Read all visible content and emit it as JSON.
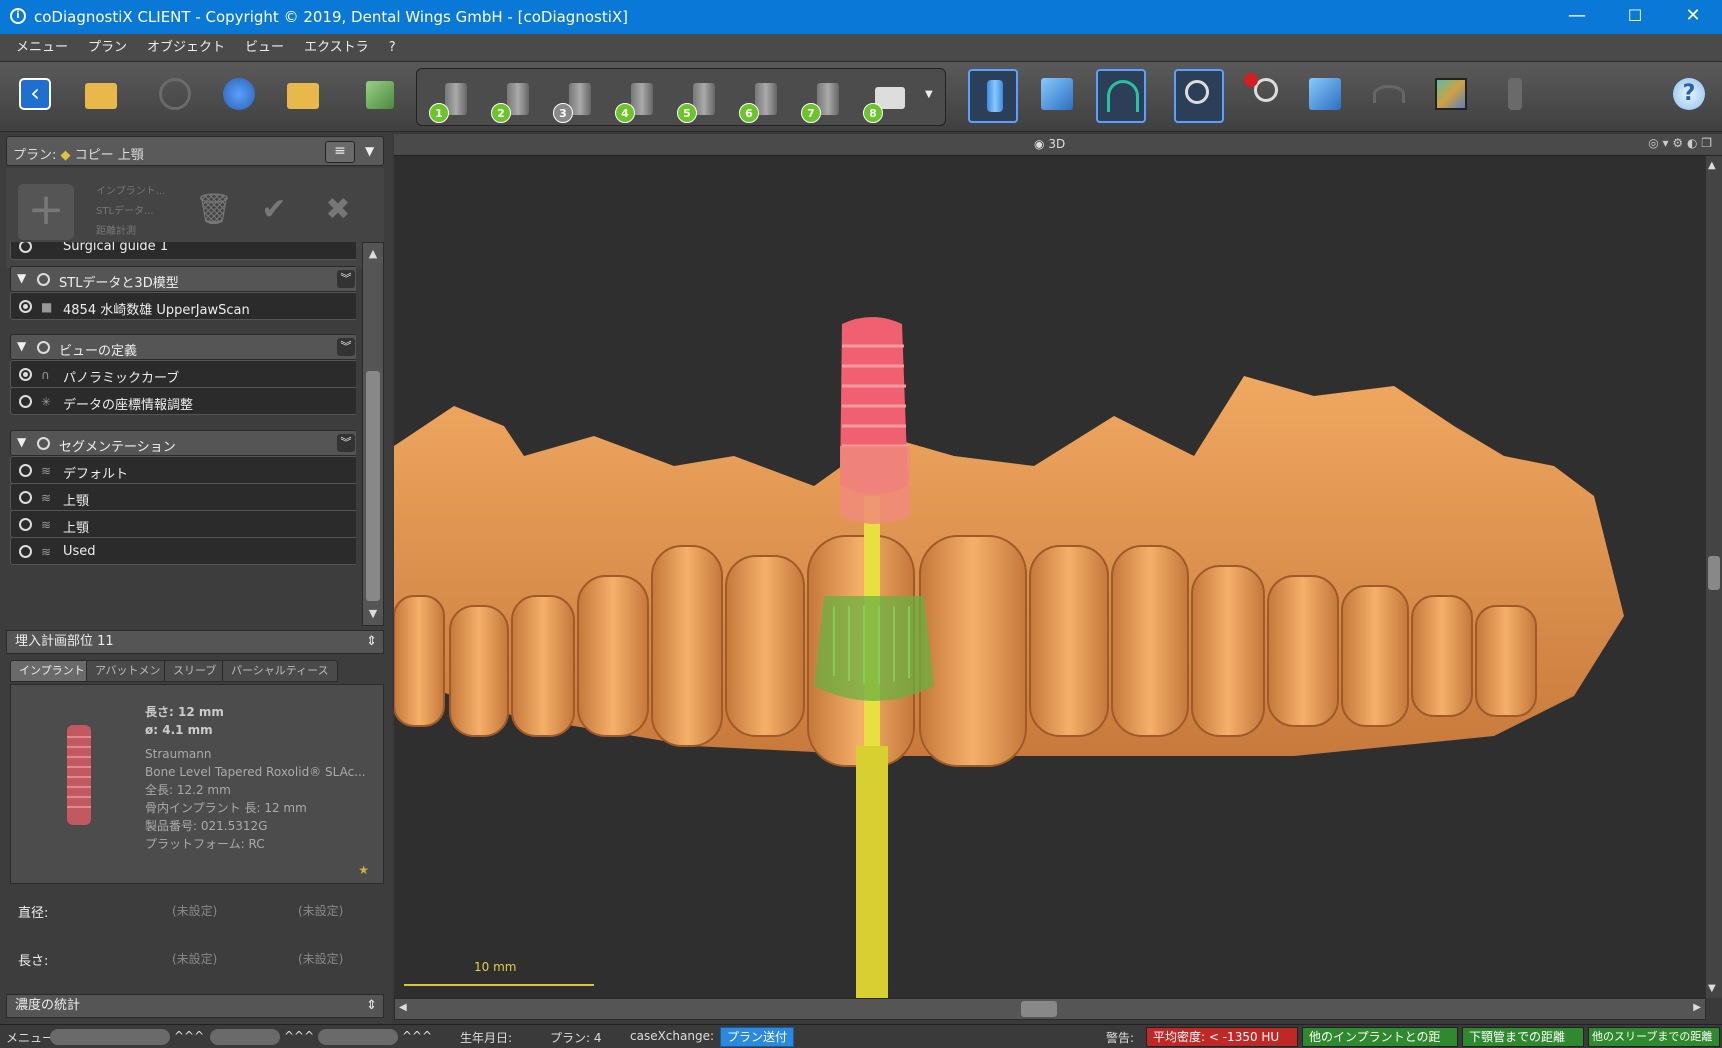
{
  "window": {
    "title": "coDiagnostiX CLIENT - Copyright © 2019, Dental Wings GmbH - [coDiagnostiX]",
    "minimize": "—",
    "maximize": "☐",
    "close": "✕"
  },
  "menu": [
    "メニュー",
    "プラン",
    "オブジェクト",
    "ビュー",
    "エクストラ",
    "?"
  ],
  "toolbar": {
    "steps": [
      "1",
      "2",
      "3",
      "4",
      "5",
      "6",
      "7",
      "8"
    ]
  },
  "plan_panel": {
    "label": "プラン:",
    "name": "コピー 上顎",
    "menu_glyph": "≡",
    "dropdown_glyph": "▼",
    "add_options": [
      "インプラント...",
      "STLデータ...",
      "距離計測"
    ]
  },
  "tree": {
    "top_item": "Surgical guide 1",
    "sections": [
      {
        "title": "STLデータと3D模型",
        "items": [
          {
            "label": "4854 水崎数雄 UpperJawScan",
            "selected": true
          }
        ]
      },
      {
        "title": "ビューの定義",
        "items": [
          {
            "label": "パノラミックカーブ",
            "selected": true
          },
          {
            "label": "データの座標情報調整",
            "selected": false
          }
        ]
      },
      {
        "title": "セグメンテーション",
        "items": [
          {
            "label": "デフォルト",
            "selected": false
          },
          {
            "label": "上顎",
            "selected": false
          },
          {
            "label": "上顎",
            "selected": false
          },
          {
            "label": "Used",
            "selected": false
          }
        ]
      }
    ]
  },
  "implant": {
    "header": "埋入計画部位 11",
    "tabs": [
      "インプラント",
      "アバットメント",
      "スリーブ",
      "パーシャルティース"
    ],
    "length": "長さ: 12 mm",
    "diameter": "ø: 4.1 mm",
    "brand": "Straumann",
    "product": "Bone Level Tapered Roxolid® SLAc...",
    "total_length": "全長: 12.2 mm",
    "bone_length": "骨内インプラント 長: 12 mm",
    "article": "製品番号: 021.5312G",
    "platform": "プラットフォーム: RC",
    "diameter_label": "直径:",
    "length_label": "長さ:",
    "unset": "(未設定)"
  },
  "stats_header": "濃度の統計",
  "view": {
    "title": "3D",
    "scale_label": "10 mm"
  },
  "status": {
    "menu": "メニュー:",
    "masked": "^^^",
    "birthdate": "生年月日:",
    "plan": "プラン:  4",
    "casex": "caseXchange:",
    "send_btn": "プラン送付",
    "warning": "警告:",
    "badges": [
      {
        "label": "平均密度: < -1350 HU",
        "color": "#c02828"
      },
      {
        "label": "他のインプラントとの距離",
        "color": "#2f8a2f"
      },
      {
        "label": "下顎管までの距離",
        "color": "#2f8a2f"
      },
      {
        "label": "他のスリーブまでの距離",
        "color": "#2f8a2f"
      }
    ]
  }
}
